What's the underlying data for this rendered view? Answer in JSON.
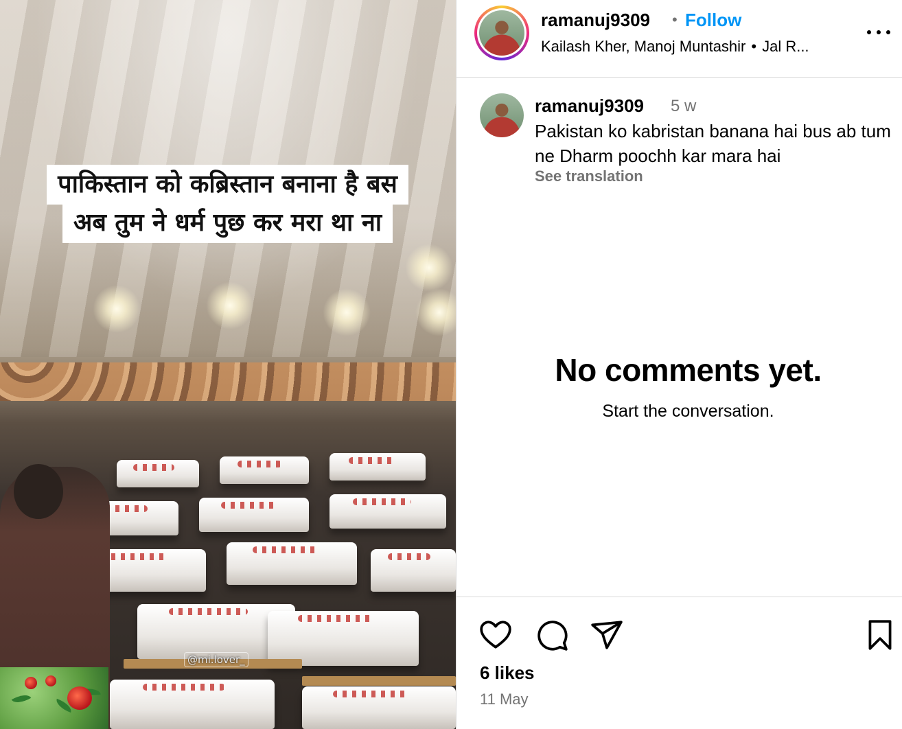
{
  "media": {
    "overlay_line1": "पाकिस्तान को  कब्रिस्तान बनाना है बस",
    "overlay_line2": "अब तुम ने धर्म पुछ कर मरा था ना",
    "watermark": "@mi.lover_"
  },
  "header": {
    "username": "ramanuj9309",
    "dot": "•",
    "follow_label": "Follow",
    "audio_artists": "Kailash Kher, Manoj Muntashir",
    "audio_sep": "•",
    "audio_title": "Jal R..."
  },
  "caption": {
    "username": "ramanuj9309",
    "time": "5 w",
    "text": "Pakistan ko kabristan banana hai bus ab tum ne Dharm poochh kar mara hai",
    "see_translation": "See translation"
  },
  "comments": {
    "empty_title": "No comments yet.",
    "empty_subtitle": "Start the conversation."
  },
  "actions": {
    "icons": [
      "heart-icon",
      "comment-icon",
      "share-icon",
      "bookmark-icon"
    ],
    "likes": "6 likes",
    "date": "11 May"
  },
  "colors": {
    "follow": "#0095f6",
    "secondary_text": "#737373",
    "divider": "#dbdbdb"
  }
}
